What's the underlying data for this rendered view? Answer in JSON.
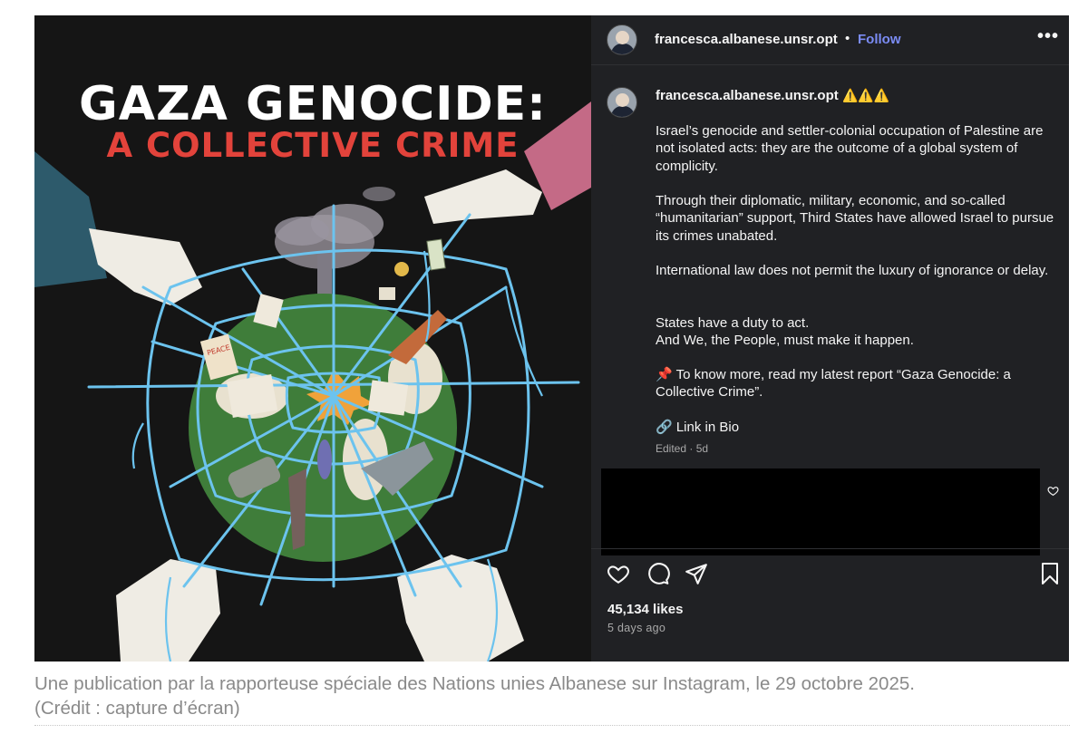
{
  "artwork": {
    "title_line1": "GAZA GENOCIDE:",
    "title_line2": "A COLLECTIVE CRIME",
    "stamp_text": "PEACE"
  },
  "post": {
    "username": "francesca.albanese.unsr.opt",
    "follow_label": "Follow",
    "separator": "•",
    "more_label": "•••",
    "caption_username": "francesca.albanese.unsr.opt",
    "caption_emoji": "⚠️⚠️⚠️",
    "paragraphs": [
      "Israel’s genocide and settler-colonial occupation of Palestine are not isolated acts: they are the outcome of a global system of complicity.",
      "Through their diplomatic, military, economic, and so-called “humanitarian” support, Third States have allowed Israel to pursue its crimes unabated.",
      "International law does not permit the luxury of ignorance or delay.",
      "States have a duty to act.",
      "And We, the People, must make it happen.",
      "📌 To know more, read my latest report “Gaza Genocide: a Collective Crime”.",
      "🔗 Link in Bio"
    ],
    "edited_meta": "Edited · 5d",
    "likes": "45,134 likes",
    "time_ago": "5 days ago",
    "icons": [
      "heart-icon",
      "comment-icon",
      "share-icon",
      "bookmark-icon"
    ]
  },
  "caption": {
    "line1": "Une publication par la rapporteuse spéciale des Nations unies Albanese sur Instagram, le 29 octobre 2025.",
    "line2": "(Crédit : capture d’écran)"
  },
  "colors": {
    "panel_bg": "#202124",
    "follow": "#7b8cf5",
    "title_red": "#e2433b",
    "web_blue": "#6cc3ee",
    "globe_green": "#3f7d3a"
  }
}
